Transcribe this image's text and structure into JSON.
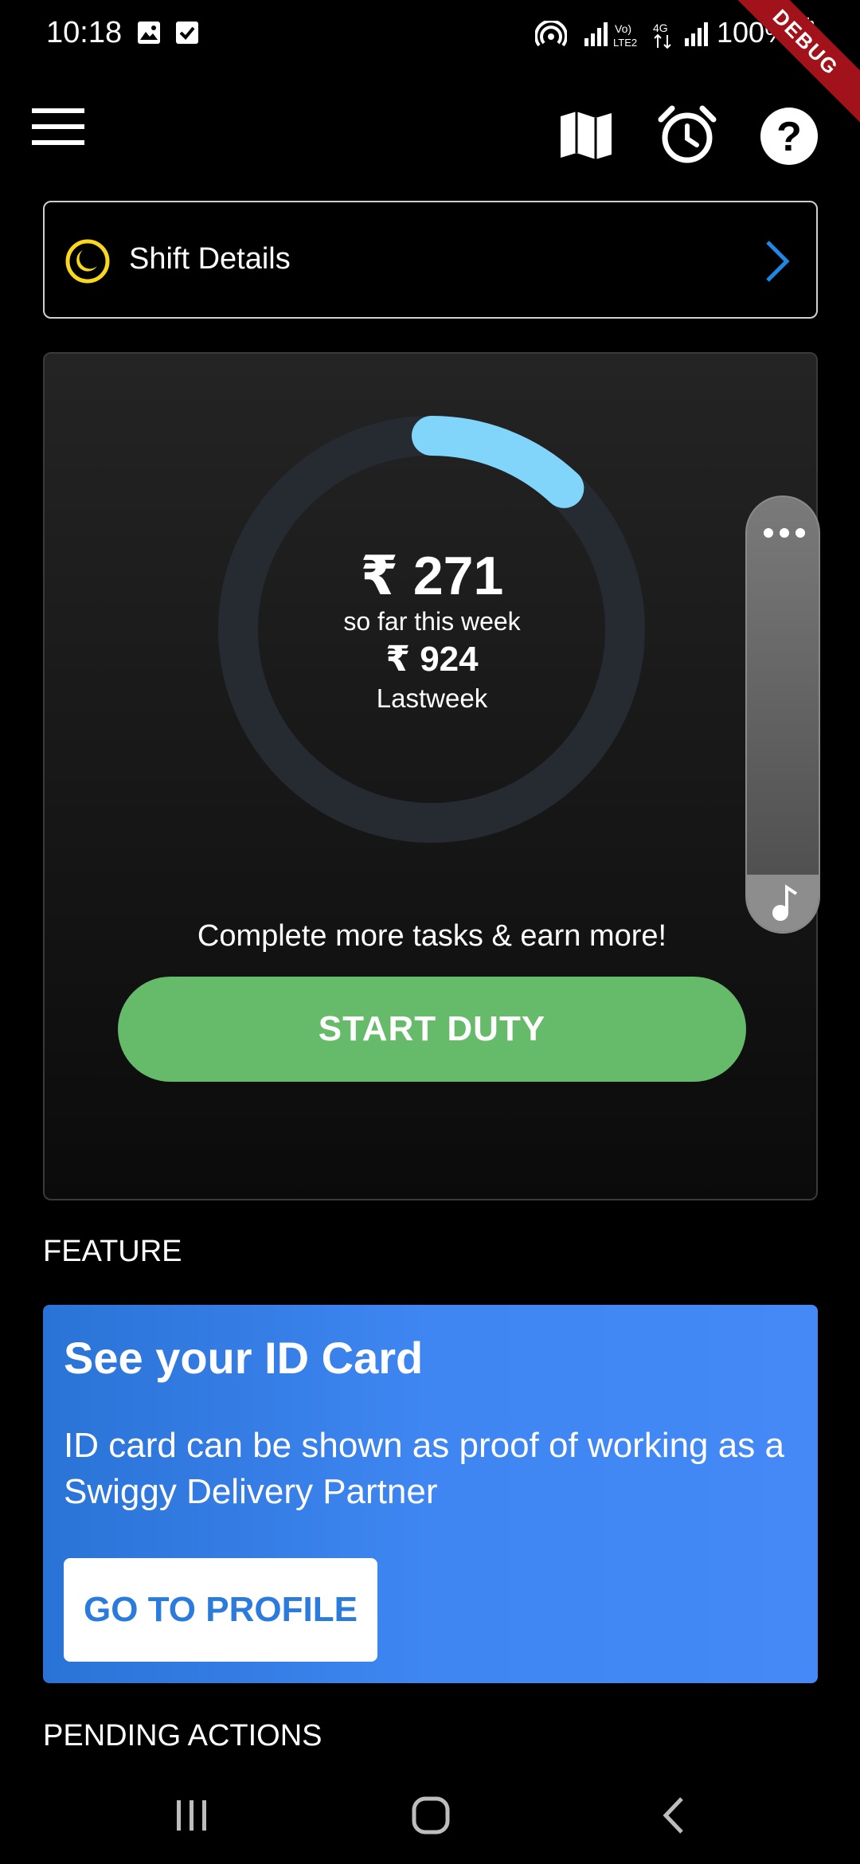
{
  "status_bar": {
    "time": "10:18",
    "battery": "100%",
    "network": "Vo) LTE2 4G",
    "debug_label": "DEBUG"
  },
  "app_bar": {
    "menu_icon": "hamburger-menu-icon",
    "map_icon": "map-icon",
    "alarm_icon": "alarm-clock-icon",
    "help_icon": "help-icon"
  },
  "shift_details": {
    "label": "Shift Details",
    "icon": "moon-icon",
    "chevron_icon": "chevron-right-icon"
  },
  "earnings": {
    "this_week_amount": "₹ 271",
    "this_week_label": "so far this week",
    "last_week_amount": "₹ 924",
    "last_week_label": "Lastweek",
    "progress_fraction": 0.12,
    "message": "Complete more tasks & earn more!",
    "start_button": "START DUTY"
  },
  "floating_panel": {
    "more_icon": "more-horizontal-icon",
    "music_icon": "music-note-icon"
  },
  "feature": {
    "section_title": "FEATURE",
    "card_title": "See your ID Card",
    "card_body": "ID card can be shown as proof of working as a Swiggy Delivery Partner",
    "button": "GO TO PROFILE"
  },
  "pending": {
    "section_title": "PENDING ACTIONS"
  },
  "colors": {
    "accent_green": "#66bb6a",
    "ring_progress": "#81d4fa",
    "feature_blue": "#4489f6",
    "chevron_blue": "#1e88e5"
  }
}
